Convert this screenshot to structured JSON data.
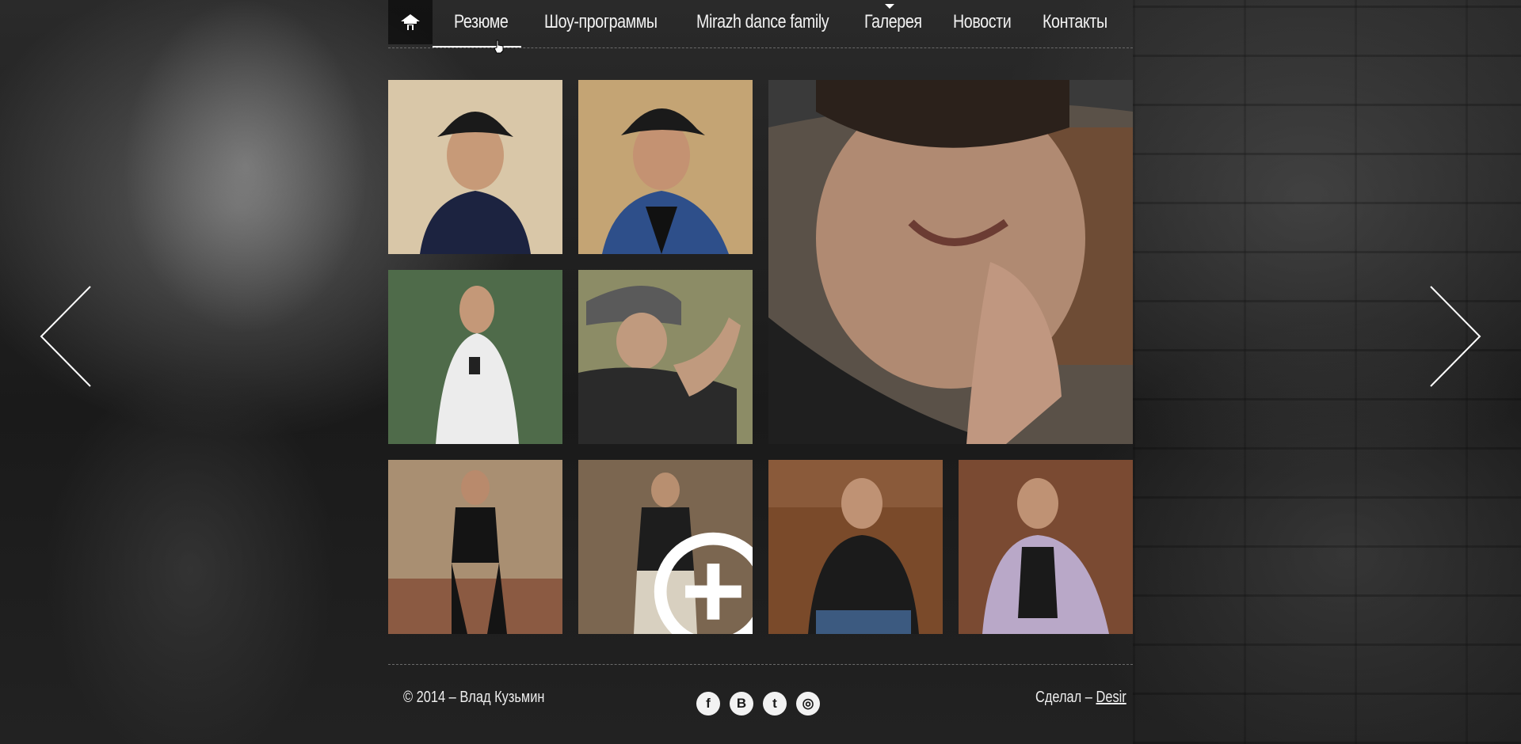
{
  "nav": {
    "home_icon": "home-icon",
    "items": [
      {
        "label": "Резюме",
        "active": true
      },
      {
        "label": "Шоу-программы"
      },
      {
        "label": "Mirazh dance family"
      },
      {
        "label": "Галерея",
        "has_dropdown": true
      },
      {
        "label": "Новости"
      },
      {
        "label": "Контакты"
      }
    ]
  },
  "gallery": {
    "tiles": [
      {
        "id": "photo-1",
        "palette": [
          "#d9c7a8",
          "#1c2340"
        ]
      },
      {
        "id": "photo-2",
        "palette": [
          "#c4a474",
          "#2e4f8a"
        ]
      },
      {
        "id": "photo-large",
        "palette": [
          "#5a5148",
          "#3a2c24"
        ]
      },
      {
        "id": "photo-3",
        "palette": [
          "#4f6b4a",
          "#e9e9e9"
        ]
      },
      {
        "id": "photo-4",
        "palette": [
          "#8c8c66",
          "#2a2a2a"
        ]
      },
      {
        "id": "photo-5",
        "palette": [
          "#a98f72",
          "#141414"
        ]
      },
      {
        "id": "photo-6",
        "palette": [
          "#7b6650",
          "#1d1d1d"
        ],
        "zoom_icon": "zoom-in-icon"
      },
      {
        "id": "photo-7",
        "palette": [
          "#8a5a3a",
          "#1b1b1b"
        ]
      },
      {
        "id": "photo-8",
        "palette": [
          "#7a4a32",
          "#b9a8c8"
        ]
      }
    ]
  },
  "footer": {
    "copyright": "© 2014 – Влад Кузьмин",
    "made_by_prefix": "Сделал –",
    "made_by_link": "Desir",
    "social": [
      {
        "name": "facebook-icon",
        "glyph": "f"
      },
      {
        "name": "vkontakte-icon",
        "glyph": "B"
      },
      {
        "name": "twitter-icon",
        "glyph": "t"
      },
      {
        "name": "instagram-icon",
        "glyph": "◎"
      }
    ]
  },
  "arrows": {
    "prev": "chevron-left-icon",
    "next": "chevron-right-icon"
  }
}
